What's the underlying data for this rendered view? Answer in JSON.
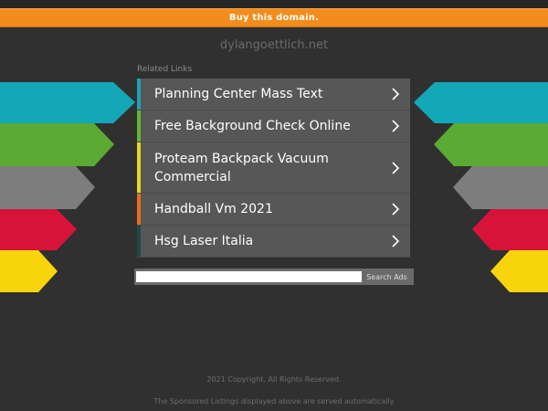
{
  "buy_bar": {
    "label": "Buy this domain."
  },
  "domain": "dylangoettlich.net",
  "related": {
    "title": "Related Links",
    "links": [
      {
        "label": "Planning Center Mass Text",
        "accent": "#1fa2b4"
      },
      {
        "label": "Free Background Check Online",
        "accent": "#63b537"
      },
      {
        "label": "Proteam Backpack Vacuum Commercial",
        "accent": "#e9d52a"
      },
      {
        "label": "Handball Vm 2021",
        "accent": "#e86e1d"
      },
      {
        "label": "Hsg Laser Italia",
        "accent": "#1b4a4d"
      }
    ]
  },
  "search": {
    "value": "",
    "button_label": "Search Ads"
  },
  "footer": {
    "copyright": "2021 Copyright. All Rights Reserved.",
    "disclaimer": "The Sponsored Listings displayed above are served automatically"
  },
  "colors": {
    "background": "#303030",
    "buy_bar": "#f28c1c",
    "arrow_teal": "#13a8b8",
    "arrow_green": "#5aaa33",
    "arrow_grey": "#7d7d7d",
    "arrow_red": "#d7133a",
    "arrow_yellow": "#f7d40c"
  },
  "icons": {
    "link_chevron": "chevron-right-icon"
  }
}
